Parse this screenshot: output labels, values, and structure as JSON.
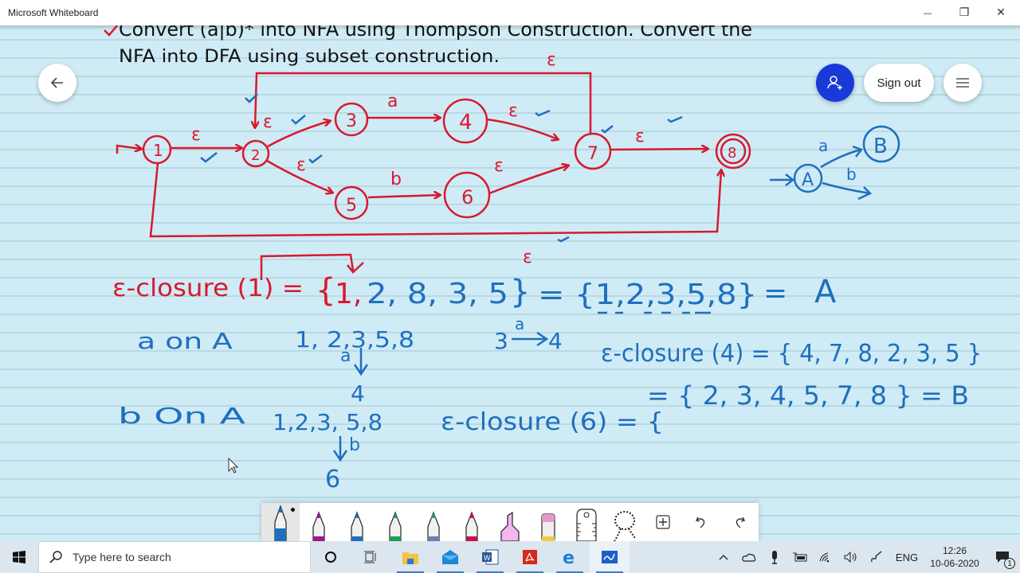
{
  "window": {
    "title": "Microsoft Whiteboard",
    "controls": {
      "minimize": "—",
      "restore": "❐",
      "close": "✕"
    }
  },
  "board_buttons": {
    "back_icon": "arrow-left",
    "invite_icon": "person-add",
    "sign_out_label": "Sign out",
    "menu_icon": "hamburger-menu"
  },
  "colors": {
    "canvas_bg": "#cfebf5",
    "ruled_line": "#b9d9e4",
    "red_ink": "#d7192f",
    "blue_ink": "#1f6fbf",
    "black_ink": "#111111",
    "accent_invite": "#1a39d9"
  },
  "whiteboard": {
    "question_line1": "Convert (a|b)* into NFA using Thompson Construction. Convert the",
    "question_line2": "NFA into DFA using subset construction.",
    "nfa": {
      "states": [
        "1",
        "2",
        "3",
        "4",
        "5",
        "6",
        "7",
        "8"
      ],
      "start_state": "1",
      "final_state": "8",
      "transitions": [
        {
          "from": "1",
          "to": "2",
          "label": "ε"
        },
        {
          "from": "2",
          "to": "3",
          "label": "ε"
        },
        {
          "from": "2",
          "to": "5",
          "label": "ε"
        },
        {
          "from": "3",
          "to": "4",
          "label": "a"
        },
        {
          "from": "5",
          "to": "6",
          "label": "b"
        },
        {
          "from": "4",
          "to": "7",
          "label": "ε"
        },
        {
          "from": "6",
          "to": "7",
          "label": "ε"
        },
        {
          "from": "7",
          "to": "8",
          "label": "ε"
        },
        {
          "from": "7",
          "to": "2",
          "label": "ε"
        },
        {
          "from": "1",
          "to": "8",
          "label": "ε"
        }
      ],
      "labels": {
        "eps": "ε",
        "a": "a",
        "b": "b"
      }
    },
    "dfa": {
      "states": [
        "A",
        "B"
      ],
      "edge_a": "a",
      "edge_b": "b"
    },
    "eclosure1": {
      "lhs": "ε-closure (1) =",
      "set_open": "{",
      "first": "1,",
      "rest": "2, 8, 3, 5",
      "set_close": "}",
      "sorted": "= {1,2,3,5,8}",
      "eq": "=",
      "name": "A"
    },
    "a_on_A": {
      "label": "a  on A",
      "set": "1, 2,3,5,8",
      "arrow_label": "a",
      "result": "4",
      "note_from": "3",
      "note_label": "a",
      "note_to": "4"
    },
    "b_on_A": {
      "label": "b   On   A",
      "set": "1,2,3, 5,8",
      "arrow_label": "b",
      "result": "6"
    },
    "eclosure4": {
      "line1": "ε-closure (4) = { 4, 7, 8, 2, 3, 5 }",
      "line2": "= { 2, 3, 4, 5, 7, 8 } = B"
    },
    "eclosure6": {
      "line": "ε-closure (6) = {"
    }
  },
  "pen_toolbar": {
    "tools": [
      {
        "name": "pen-blue-active",
        "color": "#1f6fbf",
        "active": true
      },
      {
        "name": "pen-magenta",
        "color": "#a0178f"
      },
      {
        "name": "pen-blue",
        "color": "#1f6fbf"
      },
      {
        "name": "pen-green",
        "color": "#1e9e53"
      },
      {
        "name": "pen-galaxy",
        "color": "#4a8f9f"
      },
      {
        "name": "pen-red",
        "color": "#c4134f"
      },
      {
        "name": "highlighter",
        "color": "#f3b6ef"
      },
      {
        "name": "eraser",
        "color": "#e797c9"
      },
      {
        "name": "ruler",
        "color": "#ffffff"
      },
      {
        "name": "lasso",
        "color": "#ffffff"
      }
    ],
    "add_icon": "plus-square",
    "undo_icon": "undo",
    "redo_icon": "redo"
  },
  "taskbar": {
    "search_placeholder": "Type here to search",
    "apps": [
      "cortana",
      "task-view",
      "file-explorer",
      "mail",
      "word",
      "acrobat",
      "edge",
      "whiteboard"
    ],
    "language": "ENG",
    "time": "12:26",
    "date": "10-06-2020",
    "notifications_count": "1"
  }
}
